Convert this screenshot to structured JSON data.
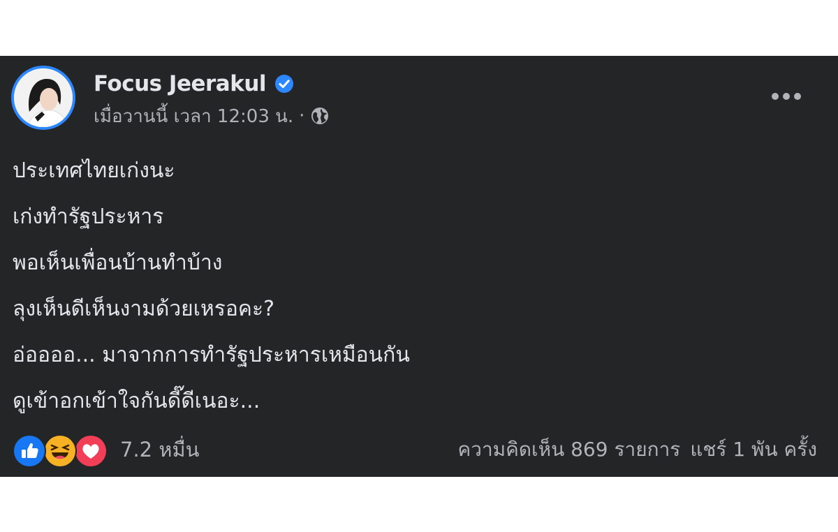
{
  "post": {
    "author": {
      "name": "Focus Jeerakul",
      "verified": true
    },
    "timestamp": "เมื่อวานนี้ เวลา 12:03 น.",
    "separator": "·",
    "privacy_icon": "globe-icon",
    "more_icon": "more-options-icon",
    "lines": [
      "ประเทศไทยเก่งนะ",
      "เก่งทำรัฐประหาร",
      "พอเห็นเพื่อนบ้านทำบ้าง",
      "ลุงเห็นดีเห็นงามด้วยเหรอคะ?",
      "อ่ออออ... มาจากการทำรัฐประหารเหมือนกัน",
      "ดูเข้าอกเข้าใจกันดี๊ดีเนอะ..."
    ],
    "reactions": {
      "icons": [
        "like-icon",
        "haha-icon",
        "love-icon"
      ],
      "count": "7.2 หมื่น"
    },
    "comments": "ความคิดเห็น 869 รายการ",
    "shares": "แชร์ 1 พัน ครั้ง"
  },
  "colors": {
    "background": "#242526",
    "text_primary": "#e4e6eb",
    "text_secondary": "#b0b3b8",
    "accent_blue": "#2d88ff"
  }
}
